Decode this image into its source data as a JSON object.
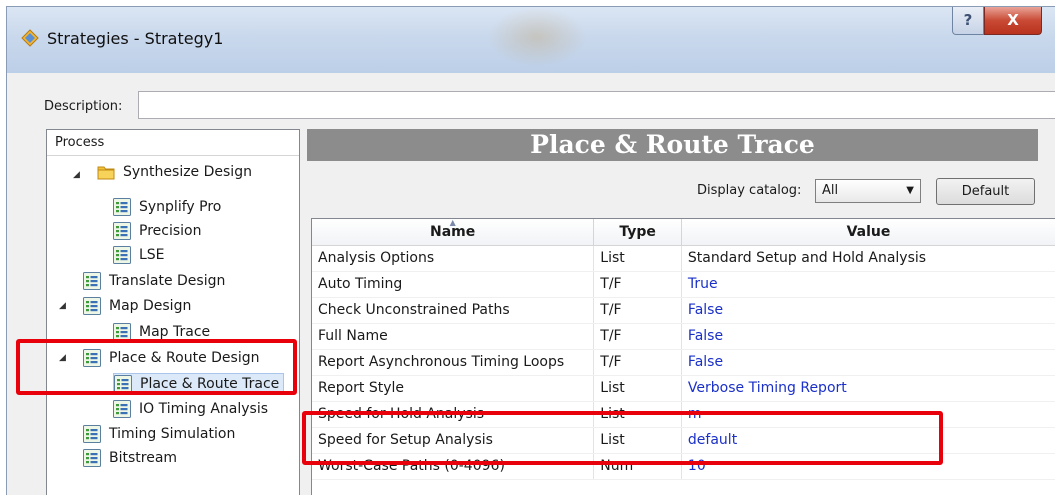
{
  "window": {
    "title": "Strategies - Strategy1",
    "help_label": "?",
    "close_label": "X"
  },
  "description": {
    "label": "Description:",
    "value": ""
  },
  "process": {
    "header": "Process",
    "items": [
      {
        "label": "Synthesize Design",
        "label2": "",
        "icon": "folder-icon",
        "expanded": true
      },
      {
        "label": "Synplify Pro",
        "label2": "",
        "icon": "strategy-doc-icon"
      },
      {
        "label": "Precision",
        "icon": "strategy-doc-icon"
      },
      {
        "label": "LSE",
        "icon": "strategy-doc-icon"
      },
      {
        "label": "Translate Design",
        "icon": "strategy-doc-icon"
      },
      {
        "label": "Map Design",
        "icon": "strategy-doc-icon",
        "expanded": true
      },
      {
        "label": "Map Trace",
        "icon": "strategy-doc-icon"
      },
      {
        "label": "Place & Route Design",
        "icon": "strategy-doc-icon",
        "expanded": true
      },
      {
        "label": "Place & Route Trace",
        "icon": "strategy-doc-icon",
        "selected": true
      },
      {
        "label": "IO Timing Analysis",
        "icon": "strategy-doc-icon"
      },
      {
        "label": "Timing Simulation",
        "icon": "strategy-doc-icon"
      },
      {
        "label": "Bitstream",
        "icon": "strategy-doc-icon"
      }
    ]
  },
  "main": {
    "banner_title": "Place & Route Trace",
    "display_catalog_label": "Display catalog:",
    "display_catalog_value": "All",
    "default_button": "Default",
    "columns": [
      "Name",
      "Type",
      "Value"
    ],
    "rows": [
      {
        "name": "Analysis Options",
        "type": "List",
        "value": "Standard Setup and Hold Analysis",
        "modified": false
      },
      {
        "name": "Auto Timing",
        "type": "T/F",
        "value": "True",
        "modified": true
      },
      {
        "name": "Check Unconstrained Paths",
        "type": "T/F",
        "value": "False",
        "modified": true
      },
      {
        "name": "Full Name",
        "type": "T/F",
        "value": "False",
        "modified": true
      },
      {
        "name": "Report Asynchronous Timing Loops",
        "type": "T/F",
        "value": "False",
        "modified": true
      },
      {
        "name": "Report Style",
        "type": "List",
        "value": "Verbose Timing Report",
        "modified": true
      },
      {
        "name": "Speed for Hold Analysis",
        "type": "List",
        "value": "m",
        "modified": true
      },
      {
        "name": "Speed for Setup Analysis",
        "type": "List",
        "value": "default",
        "modified": true
      },
      {
        "name": "Worst-Case Paths (0-4096)",
        "type": "Num",
        "value": "10",
        "modified": true
      }
    ]
  },
  "colors": {
    "highlight": "#e8000b",
    "value_blue": "#1a30c8",
    "banner_gray": "#8c8c8c"
  }
}
